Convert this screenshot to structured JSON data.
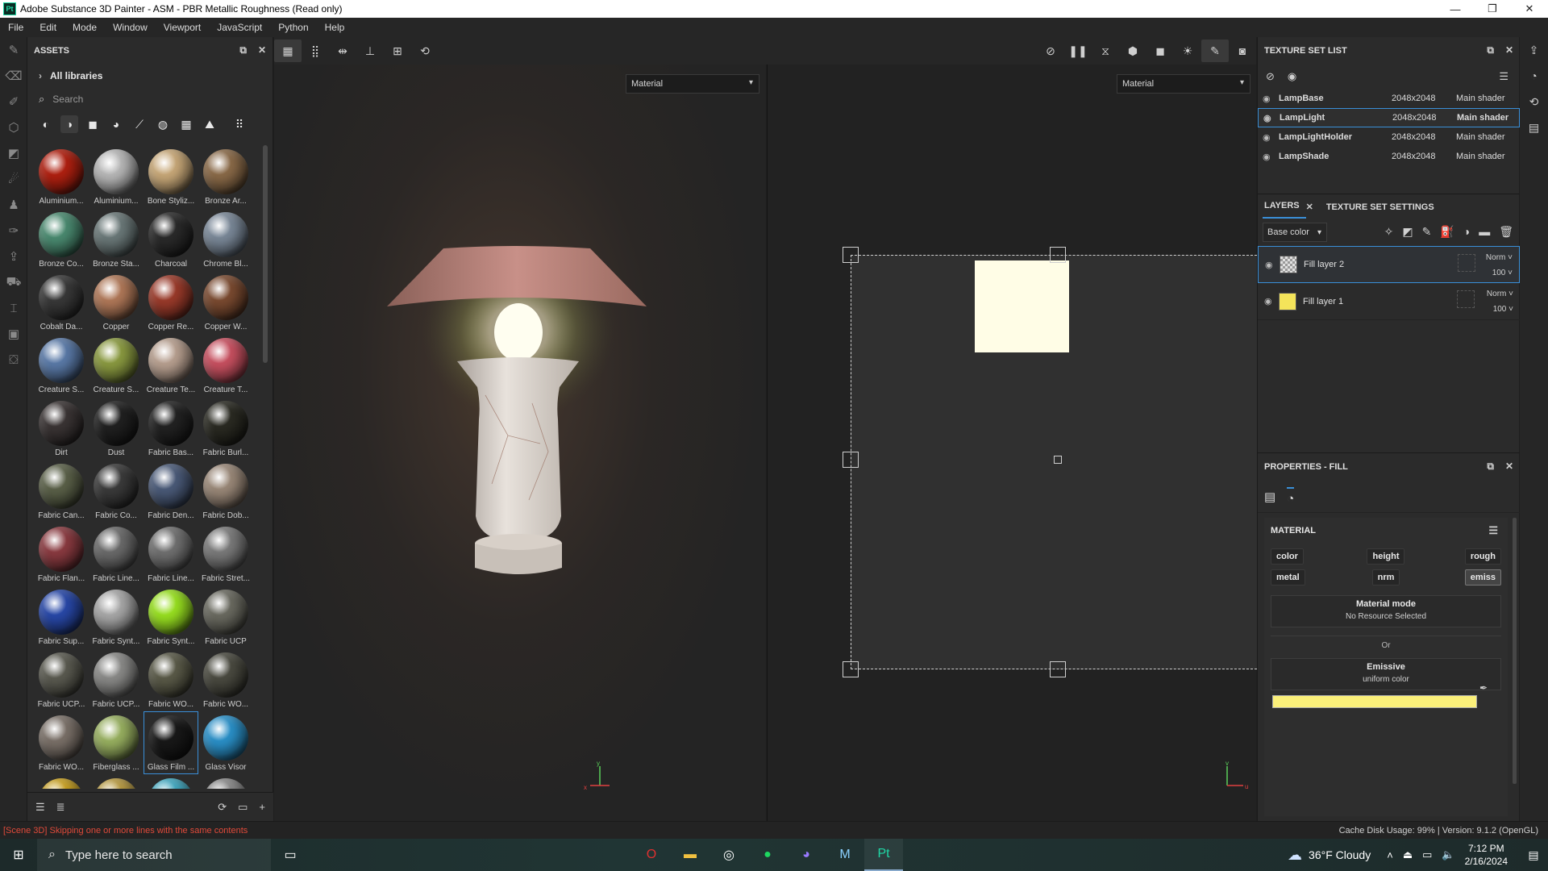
{
  "window": {
    "title": "Adobe Substance 3D Painter - ASM - PBR Metallic Roughness (Read only)",
    "app_icon_text": "Pt",
    "controls": [
      "—",
      "❐",
      "✕"
    ]
  },
  "menu": [
    "File",
    "Edit",
    "Mode",
    "Window",
    "Viewport",
    "JavaScript",
    "Python",
    "Help"
  ],
  "left_tools": [
    "paint-brush",
    "eraser",
    "projection",
    "geometry-mask",
    "polygon-fill",
    "smudge",
    "clone",
    "color-picker",
    "bake",
    "material-picker",
    "measure",
    "export",
    "share"
  ],
  "assets": {
    "title": "ASSETS",
    "all_libraries": "All libraries",
    "search_placeholder": "Search",
    "items": [
      {
        "label": "Aluminium...",
        "color": "#b02010"
      },
      {
        "label": "Aluminium...",
        "color": "#b8b8b8"
      },
      {
        "label": "Bone Styliz...",
        "color": "#c8a878"
      },
      {
        "label": "Bronze Ar...",
        "color": "#8a6a48"
      },
      {
        "label": "Bronze Co...",
        "color": "#4a8a70"
      },
      {
        "label": "Bronze Sta...",
        "color": "#6a7878"
      },
      {
        "label": "Charcoal",
        "color": "#2a2a2a"
      },
      {
        "label": "Chrome Bl...",
        "color": "#7a8898"
      },
      {
        "label": "Cobalt Da...",
        "color": "#383838"
      },
      {
        "label": "Copper",
        "color": "#b07858"
      },
      {
        "label": "Copper Re...",
        "color": "#9a3a2a"
      },
      {
        "label": "Copper W...",
        "color": "#7a4a30"
      },
      {
        "label": "Creature S...",
        "color": "#5a7aa8"
      },
      {
        "label": "Creature S...",
        "color": "#8a9a40"
      },
      {
        "label": "Creature Te...",
        "color": "#b8a090"
      },
      {
        "label": "Creature T...",
        "color": "#c85060"
      },
      {
        "label": "Dirt",
        "color": "#3a3434"
      },
      {
        "label": "Dust",
        "color": "#202020"
      },
      {
        "label": "Fabric Bas...",
        "color": "#222222"
      },
      {
        "label": "Fabric Burl...",
        "color": "#2a2a22"
      },
      {
        "label": "Fabric Can...",
        "color": "#5a6048"
      },
      {
        "label": "Fabric Co...",
        "color": "#3a3a3a"
      },
      {
        "label": "Fabric Den...",
        "color": "#4a5a78"
      },
      {
        "label": "Fabric Dob...",
        "color": "#9a8878"
      },
      {
        "label": "Fabric Flan...",
        "color": "#8a3a40"
      },
      {
        "label": "Fabric Line...",
        "color": "#6a6a6a"
      },
      {
        "label": "Fabric Line...",
        "color": "#707070"
      },
      {
        "label": "Fabric Stret...",
        "color": "#7a7a7a"
      },
      {
        "label": "Fabric Sup...",
        "color": "#2848a8"
      },
      {
        "label": "Fabric Synt...",
        "color": "#a8a8a8"
      },
      {
        "label": "Fabric Synt...",
        "color": "#98e020"
      },
      {
        "label": "Fabric UCP",
        "color": "#6a6a60"
      },
      {
        "label": "Fabric UCP...",
        "color": "#5a5a50"
      },
      {
        "label": "Fabric UCP...",
        "color": "#8a8a88"
      },
      {
        "label": "Fabric WO...",
        "color": "#5a5a48"
      },
      {
        "label": "Fabric WO...",
        "color": "#4a4a40"
      },
      {
        "label": "Fabric WO...",
        "color": "#7a7068"
      },
      {
        "label": "Fiberglass ...",
        "color": "#98b060"
      },
      {
        "label": "Glass Film ...",
        "color": "#181818"
      },
      {
        "label": "Glass Visor",
        "color": "#2a90c8"
      },
      {
        "label": "",
        "color": "#c8a020"
      },
      {
        "label": "",
        "color": "#b89a40"
      },
      {
        "label": "",
        "color": "#40a8c0"
      },
      {
        "label": "",
        "color": "#8a8a8a"
      }
    ],
    "selected_index": 38
  },
  "viewport": {
    "dropdown_left": "Material",
    "dropdown_right": "Material",
    "axis_3d": {
      "x": "x",
      "y": "y"
    },
    "axis_2d": {
      "u": "u",
      "v": "v"
    }
  },
  "texture_set_list": {
    "title": "TEXTURE SET LIST",
    "rows": [
      {
        "name": "LampBase",
        "res": "2048x2048",
        "shader": "Main shader",
        "selected": false
      },
      {
        "name": "LampLight",
        "res": "2048x2048",
        "shader": "Main shader",
        "selected": true
      },
      {
        "name": "LampLightHolder",
        "res": "2048x2048",
        "shader": "Main shader",
        "selected": false
      },
      {
        "name": "LampShade",
        "res": "2048x2048",
        "shader": "Main shader",
        "selected": false
      }
    ]
  },
  "layers": {
    "tab_layers": "LAYERS",
    "tab_settings": "TEXTURE SET SETTINGS",
    "channel": "Base color",
    "items": [
      {
        "name": "Fill layer 2",
        "blend": "Norm",
        "opacity": "100",
        "selected": true,
        "thumb": "checker"
      },
      {
        "name": "Fill layer 1",
        "blend": "Norm",
        "opacity": "100",
        "selected": false,
        "thumb": "#f4e45a"
      }
    ]
  },
  "properties": {
    "title": "PROPERTIES - FILL",
    "material_label": "MATERIAL",
    "channels": [
      "color",
      "height",
      "rough",
      "metal",
      "nrm",
      "emiss"
    ],
    "active_channel": "emiss",
    "material_mode_title": "Material mode",
    "material_mode_value": "No Resource Selected",
    "or_label": "Or",
    "emissive_title": "Emissive",
    "emissive_value": "uniform color",
    "emissive_color": "#fbf07a"
  },
  "status": {
    "message": "[Scene 3D] Skipping one or more lines with the same contents",
    "info": "Cache Disk Usage:   99% | Version: 9.1.2 (OpenGL)"
  },
  "taskbar": {
    "search_placeholder": "Type here to search",
    "weather": "36°F  Cloudy",
    "time": "7:12 PM",
    "date": "2/16/2024"
  }
}
